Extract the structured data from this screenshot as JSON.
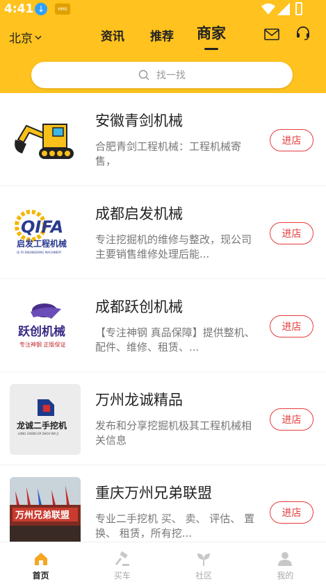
{
  "status": {
    "time": "4:41",
    "hms_badge": "HMS"
  },
  "header": {
    "city": "北京",
    "tabs": [
      {
        "label": "资讯"
      },
      {
        "label": "推荐"
      },
      {
        "label": "商家",
        "active": true
      }
    ]
  },
  "search": {
    "placeholder": "找一找"
  },
  "shops": [
    {
      "name": "安徽青剑机械",
      "desc": "合肥青剑工程机械：工程机械寄售，",
      "button": "进店",
      "logo": "excavator-logo"
    },
    {
      "name": "成都启发机械",
      "desc": "专注挖掘机的维修与整改，现公司主要销售维修处理后能...",
      "button": "进店",
      "logo_text": "QIFA",
      "logo_sub": "启发工程机械",
      "logo_tiny": "QI FA ENGINEERING MACHINERY"
    },
    {
      "name": "成都跃创机械",
      "desc": "【专注神钢 真品保障】提供整机、配件、维修、租赁、...",
      "button": "进店",
      "logo_text": "跃创机械",
      "logo_sub": "专注神钢  正版保证"
    },
    {
      "name": "万州龙诚精品",
      "desc": "发布和分享挖掘机极其工程机械相关信息",
      "button": "进店",
      "logo_text": "龙诚二手挖机",
      "logo_sub": "LONG CHENG ER SHOU WA JI"
    },
    {
      "name": "重庆万州兄弟联盟",
      "desc": "专业二手挖机 买、 卖、 评估、 置换、 租赁，所有挖...",
      "button": "进店",
      "logo_text": "万州兄弟联盟"
    }
  ],
  "bottom_nav": [
    {
      "label": "首页",
      "active": true
    },
    {
      "label": "买车"
    },
    {
      "label": "社区"
    },
    {
      "label": "我的"
    }
  ],
  "colors": {
    "brand_yellow": "#ffc21e",
    "accent_red": "#e63b3b",
    "home_icon": "#f5a623"
  }
}
